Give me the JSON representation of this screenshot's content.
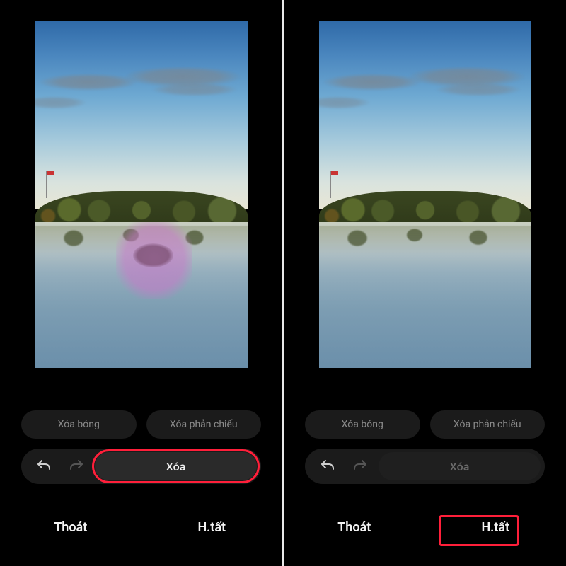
{
  "screens": [
    {
      "erase_shadow_label": "Xóa bóng",
      "erase_reflection_label": "Xóa phản chiếu",
      "erase_label": "Xóa",
      "exit_label": "Thoát",
      "done_label": "H.tất",
      "erase_active": true,
      "highlight_target": "erase"
    },
    {
      "erase_shadow_label": "Xóa bóng",
      "erase_reflection_label": "Xóa phản chiếu",
      "erase_label": "Xóa",
      "exit_label": "Thoát",
      "done_label": "H.tất",
      "erase_active": false,
      "highlight_target": "done"
    }
  ],
  "icons": {
    "undo": "undo-icon",
    "redo": "redo-icon"
  },
  "colors": {
    "highlight": "#ff1f3a",
    "background": "#000000",
    "pill_bg": "#1b1b1b",
    "pill_text": "#8b8b8b"
  }
}
